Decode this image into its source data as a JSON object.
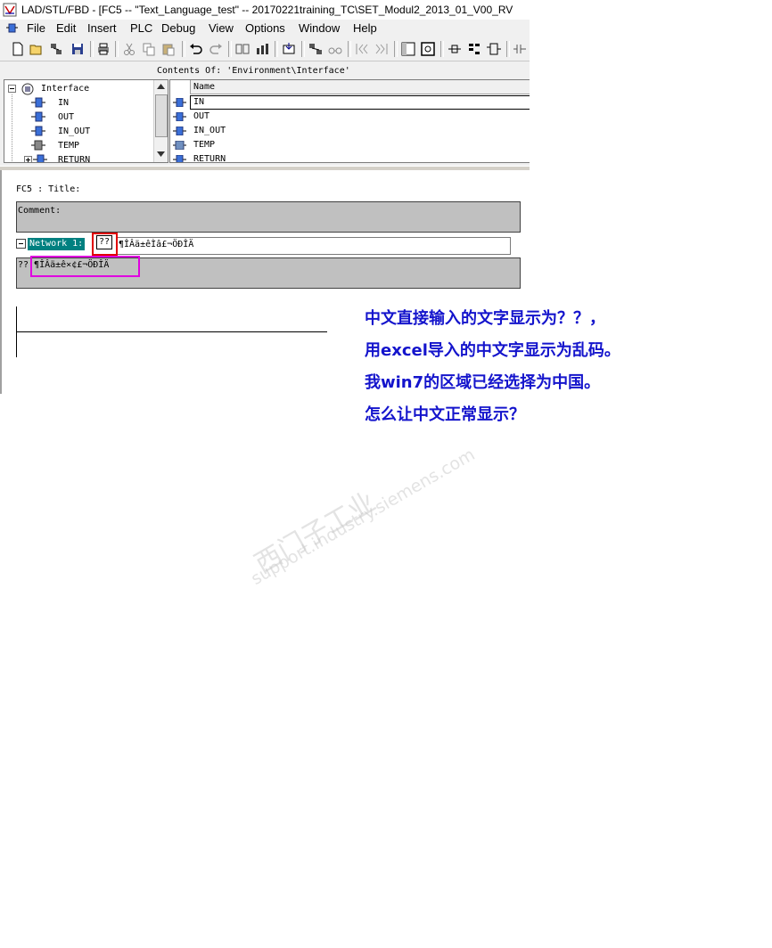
{
  "window": {
    "title": "LAD/STL/FBD  - [FC5 -- \"Text_Language_test\" -- 20170221training_TC\\SET_Modul2_2013_01_V00_RV"
  },
  "menu": {
    "items": [
      "File",
      "Edit",
      "Insert",
      "PLC",
      "Debug",
      "View",
      "Options",
      "Window",
      "Help"
    ]
  },
  "contents_header": "Contents Of: 'Environment\\Interface'",
  "tree": {
    "root": "Interface",
    "children": [
      "IN",
      "OUT",
      "IN_OUT",
      "TEMP",
      "RETURN"
    ]
  },
  "detail": {
    "column_header": "Name",
    "rows": [
      "IN",
      "OUT",
      "IN_OUT",
      "TEMP",
      "RETURN"
    ]
  },
  "editor": {
    "block_title": "FC5 : Title:",
    "comment_label": "Comment:",
    "network_label": "Network 1:",
    "network_qmarks": "??",
    "network_title_text": "¶ÎÂä±êÌâ£¬ÖÐÎÄ",
    "network_comment": "?? ¶ÎÂä±ê×¢£¬ÖÐÎÄ"
  },
  "annotation": {
    "lines": [
      "中文直接输入的文字显示为？？，",
      "用excel导入的中文字显示为乱码。",
      "我win7的区域已经选择为中国。",
      "怎么让中文正常显示？"
    ]
  },
  "watermark": {
    "line1": "西门子工业",
    "line2": "support.industry.siemens.com"
  },
  "colors": {
    "network_badge": "#008080",
    "highlight_red": "#e00000",
    "highlight_magenta": "#e000e0",
    "annotation_text": "#1414cc"
  }
}
